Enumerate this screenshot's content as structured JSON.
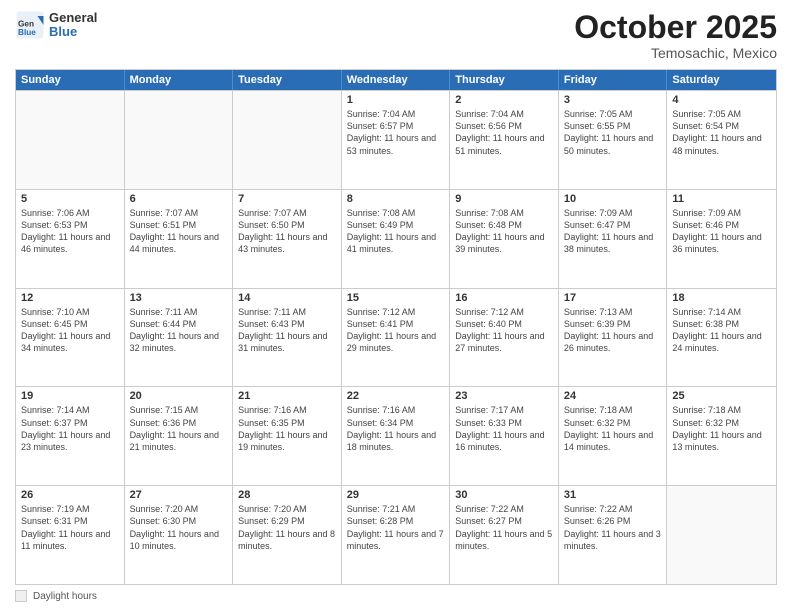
{
  "header": {
    "logo_general": "General",
    "logo_blue": "Blue",
    "month_title": "October 2025",
    "subtitle": "Temosachic, Mexico"
  },
  "weekdays": [
    "Sunday",
    "Monday",
    "Tuesday",
    "Wednesday",
    "Thursday",
    "Friday",
    "Saturday"
  ],
  "weeks": [
    [
      {
        "day": "",
        "info": "",
        "empty": true
      },
      {
        "day": "",
        "info": "",
        "empty": true
      },
      {
        "day": "",
        "info": "",
        "empty": true
      },
      {
        "day": "1",
        "info": "Sunrise: 7:04 AM\nSunset: 6:57 PM\nDaylight: 11 hours\nand 53 minutes.",
        "empty": false
      },
      {
        "day": "2",
        "info": "Sunrise: 7:04 AM\nSunset: 6:56 PM\nDaylight: 11 hours\nand 51 minutes.",
        "empty": false
      },
      {
        "day": "3",
        "info": "Sunrise: 7:05 AM\nSunset: 6:55 PM\nDaylight: 11 hours\nand 50 minutes.",
        "empty": false
      },
      {
        "day": "4",
        "info": "Sunrise: 7:05 AM\nSunset: 6:54 PM\nDaylight: 11 hours\nand 48 minutes.",
        "empty": false
      }
    ],
    [
      {
        "day": "5",
        "info": "Sunrise: 7:06 AM\nSunset: 6:53 PM\nDaylight: 11 hours\nand 46 minutes.",
        "empty": false
      },
      {
        "day": "6",
        "info": "Sunrise: 7:07 AM\nSunset: 6:51 PM\nDaylight: 11 hours\nand 44 minutes.",
        "empty": false
      },
      {
        "day": "7",
        "info": "Sunrise: 7:07 AM\nSunset: 6:50 PM\nDaylight: 11 hours\nand 43 minutes.",
        "empty": false
      },
      {
        "day": "8",
        "info": "Sunrise: 7:08 AM\nSunset: 6:49 PM\nDaylight: 11 hours\nand 41 minutes.",
        "empty": false
      },
      {
        "day": "9",
        "info": "Sunrise: 7:08 AM\nSunset: 6:48 PM\nDaylight: 11 hours\nand 39 minutes.",
        "empty": false
      },
      {
        "day": "10",
        "info": "Sunrise: 7:09 AM\nSunset: 6:47 PM\nDaylight: 11 hours\nand 38 minutes.",
        "empty": false
      },
      {
        "day": "11",
        "info": "Sunrise: 7:09 AM\nSunset: 6:46 PM\nDaylight: 11 hours\nand 36 minutes.",
        "empty": false
      }
    ],
    [
      {
        "day": "12",
        "info": "Sunrise: 7:10 AM\nSunset: 6:45 PM\nDaylight: 11 hours\nand 34 minutes.",
        "empty": false
      },
      {
        "day": "13",
        "info": "Sunrise: 7:11 AM\nSunset: 6:44 PM\nDaylight: 11 hours\nand 32 minutes.",
        "empty": false
      },
      {
        "day": "14",
        "info": "Sunrise: 7:11 AM\nSunset: 6:43 PM\nDaylight: 11 hours\nand 31 minutes.",
        "empty": false
      },
      {
        "day": "15",
        "info": "Sunrise: 7:12 AM\nSunset: 6:41 PM\nDaylight: 11 hours\nand 29 minutes.",
        "empty": false
      },
      {
        "day": "16",
        "info": "Sunrise: 7:12 AM\nSunset: 6:40 PM\nDaylight: 11 hours\nand 27 minutes.",
        "empty": false
      },
      {
        "day": "17",
        "info": "Sunrise: 7:13 AM\nSunset: 6:39 PM\nDaylight: 11 hours\nand 26 minutes.",
        "empty": false
      },
      {
        "day": "18",
        "info": "Sunrise: 7:14 AM\nSunset: 6:38 PM\nDaylight: 11 hours\nand 24 minutes.",
        "empty": false
      }
    ],
    [
      {
        "day": "19",
        "info": "Sunrise: 7:14 AM\nSunset: 6:37 PM\nDaylight: 11 hours\nand 23 minutes.",
        "empty": false
      },
      {
        "day": "20",
        "info": "Sunrise: 7:15 AM\nSunset: 6:36 PM\nDaylight: 11 hours\nand 21 minutes.",
        "empty": false
      },
      {
        "day": "21",
        "info": "Sunrise: 7:16 AM\nSunset: 6:35 PM\nDaylight: 11 hours\nand 19 minutes.",
        "empty": false
      },
      {
        "day": "22",
        "info": "Sunrise: 7:16 AM\nSunset: 6:34 PM\nDaylight: 11 hours\nand 18 minutes.",
        "empty": false
      },
      {
        "day": "23",
        "info": "Sunrise: 7:17 AM\nSunset: 6:33 PM\nDaylight: 11 hours\nand 16 minutes.",
        "empty": false
      },
      {
        "day": "24",
        "info": "Sunrise: 7:18 AM\nSunset: 6:32 PM\nDaylight: 11 hours\nand 14 minutes.",
        "empty": false
      },
      {
        "day": "25",
        "info": "Sunrise: 7:18 AM\nSunset: 6:32 PM\nDaylight: 11 hours\nand 13 minutes.",
        "empty": false
      }
    ],
    [
      {
        "day": "26",
        "info": "Sunrise: 7:19 AM\nSunset: 6:31 PM\nDaylight: 11 hours\nand 11 minutes.",
        "empty": false
      },
      {
        "day": "27",
        "info": "Sunrise: 7:20 AM\nSunset: 6:30 PM\nDaylight: 11 hours\nand 10 minutes.",
        "empty": false
      },
      {
        "day": "28",
        "info": "Sunrise: 7:20 AM\nSunset: 6:29 PM\nDaylight: 11 hours\nand 8 minutes.",
        "empty": false
      },
      {
        "day": "29",
        "info": "Sunrise: 7:21 AM\nSunset: 6:28 PM\nDaylight: 11 hours\nand 7 minutes.",
        "empty": false
      },
      {
        "day": "30",
        "info": "Sunrise: 7:22 AM\nSunset: 6:27 PM\nDaylight: 11 hours\nand 5 minutes.",
        "empty": false
      },
      {
        "day": "31",
        "info": "Sunrise: 7:22 AM\nSunset: 6:26 PM\nDaylight: 11 hours\nand 3 minutes.",
        "empty": false
      },
      {
        "day": "",
        "info": "",
        "empty": true
      }
    ]
  ],
  "legend": {
    "label": "Daylight hours"
  }
}
